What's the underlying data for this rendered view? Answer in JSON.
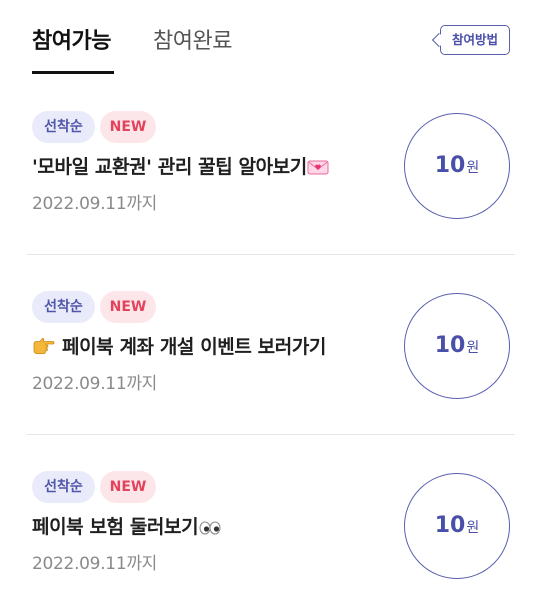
{
  "tabs": [
    {
      "label": "참여가능"
    },
    {
      "label": "참여완료"
    }
  ],
  "how_button": {
    "label": "참여방법"
  },
  "items": [
    {
      "badge_first": "선착순",
      "badge_new": "NEW",
      "title": "'모바일 교환권' 관리 꿀팁 알아보기",
      "date": "2022.09.11까지",
      "reward": "10",
      "reward_unit": "원",
      "icon": "heart-letter-icon"
    },
    {
      "badge_first": "선착순",
      "badge_new": "NEW",
      "title": "페이북 계좌 개설 이벤트 보러가기",
      "date": "2022.09.11까지",
      "reward": "10",
      "reward_unit": "원",
      "icon": "pointing-hand-icon"
    },
    {
      "badge_first": "선착순",
      "badge_new": "NEW",
      "title": "페이북 보험 둘러보기",
      "date": "2022.09.11까지",
      "reward": "10",
      "reward_unit": "원",
      "icon": "eyes-icon"
    }
  ],
  "colors": {
    "accent": "#4a4fa8",
    "new_badge": "#e4435c",
    "first_badge_bg": "#e9ebfa",
    "new_badge_bg": "#fde6ea"
  }
}
